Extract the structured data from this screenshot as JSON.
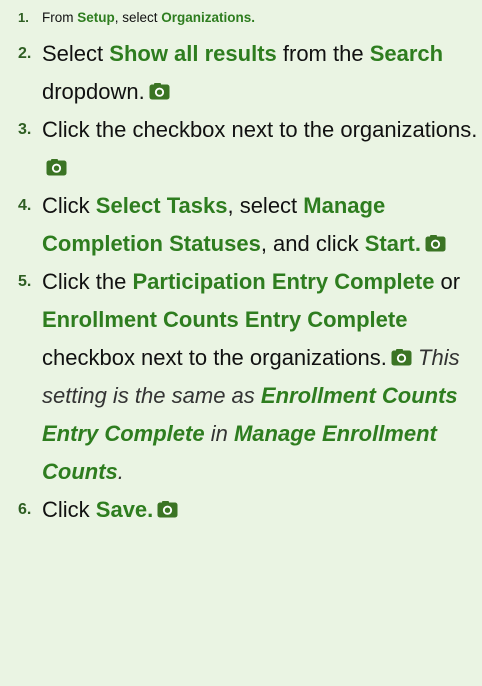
{
  "colors": {
    "background": "#eaf4e3",
    "number": "#2e5e22",
    "emphasis": "#2e7d1f",
    "icon": "#3b7424"
  },
  "steps": [
    {
      "num": "1.",
      "t1": "From ",
      "b1": "Setup",
      "t2": ", select ",
      "b2": "Organizations."
    },
    {
      "num": "2.",
      "t1": "Select ",
      "b1": "Show all results",
      "t2": " from the ",
      "b2": "Search",
      "t3": " dropdown."
    },
    {
      "num": "3.",
      "t1": "Click the checkbox next to the organizations."
    },
    {
      "num": "4.",
      "t1": "Click ",
      "b1": "Select Tasks",
      "t2": ", select ",
      "b2": "Manage Completion Statuses",
      "t3": ", and click ",
      "b3": "Start."
    },
    {
      "num": "5.",
      "t1": "Click the ",
      "b1": "Participation Entry Complete",
      "t2": " or ",
      "b2": "Enrollment Counts Entry Complete",
      "t3": " checkbox next to the organizations.",
      "note": {
        "t1": "This setting is the same as ",
        "b1": "Enrollment Counts Entry Complete",
        "t2": " in ",
        "b2": "Manage Enrollment Counts",
        "t3": "."
      }
    },
    {
      "num": "6.",
      "t1": "Click ",
      "b1": "Save."
    }
  ]
}
